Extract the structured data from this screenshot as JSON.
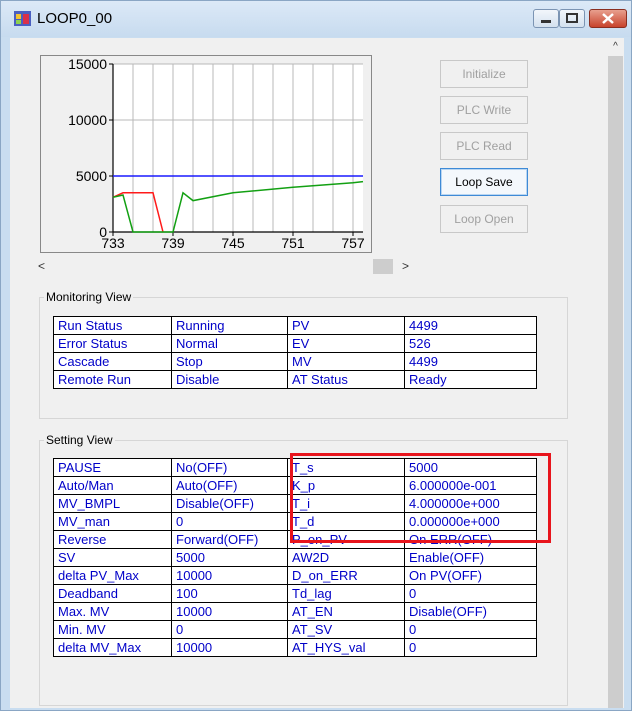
{
  "window": {
    "title": "LOOP0_00"
  },
  "buttons": {
    "initialize": "Initialize",
    "plc_write": "PLC Write",
    "plc_read": "PLC Read",
    "loop_save": "Loop Save",
    "loop_open": "Loop Open"
  },
  "scroll": {
    "up": "^",
    "left": "<",
    "right": ">"
  },
  "chart_data": {
    "type": "line",
    "x": [
      733,
      734,
      735,
      736,
      737,
      738,
      739,
      740,
      741,
      745,
      751,
      757,
      758
    ],
    "xticks": [
      "733",
      "739",
      "745",
      "751",
      "757"
    ],
    "yticks": [
      "0",
      "5000",
      "10000",
      "15000"
    ],
    "ylim": [
      0,
      15000
    ],
    "xlim": [
      733,
      758
    ],
    "grid": true,
    "series": [
      {
        "color": "#1a1aff",
        "values": [
          5000,
          5000,
          5000,
          5000,
          5000,
          5000,
          5000,
          5000,
          5000,
          5000,
          5000,
          5000,
          5000
        ]
      },
      {
        "color": "#ff1a1a",
        "values": [
          3100,
          3500,
          3500,
          3500,
          3500,
          0,
          null,
          null,
          null,
          null,
          null,
          null,
          null
        ]
      },
      {
        "color": "#12a012",
        "values": [
          3100,
          3300,
          0,
          0,
          0,
          0,
          0,
          3500,
          2800,
          3500,
          4000,
          4400,
          4500
        ]
      }
    ]
  },
  "monitoring": {
    "label": "Monitoring View",
    "rows": [
      [
        "Run Status",
        "Running",
        "PV",
        "4499"
      ],
      [
        "Error Status",
        "Normal",
        "EV",
        "526"
      ],
      [
        "Cascade",
        "Stop",
        "MV",
        "4499"
      ],
      [
        "Remote Run",
        "Disable",
        "AT Status",
        "Ready"
      ]
    ]
  },
  "setting": {
    "label": "Setting View",
    "rows": [
      [
        "PAUSE",
        "No(OFF)",
        "T_s",
        "5000"
      ],
      [
        "Auto/Man",
        "Auto(OFF)",
        "K_p",
        "6.000000e-001"
      ],
      [
        "MV_BMPL",
        "Disable(OFF)",
        "T_i",
        "4.000000e+000"
      ],
      [
        "MV_man",
        "0",
        "T_d",
        "0.000000e+000"
      ],
      [
        "Reverse",
        "Forward(OFF)",
        "P_on_PV",
        "On ERR(OFF)"
      ],
      [
        "SV",
        "5000",
        "AW2D",
        "Enable(OFF)"
      ],
      [
        "delta PV_Max",
        "10000",
        "D_on_ERR",
        "On PV(OFF)"
      ],
      [
        "Deadband",
        "100",
        "Td_lag",
        "0"
      ],
      [
        "Max. MV",
        "10000",
        "AT_EN",
        "Disable(OFF)"
      ],
      [
        "Min. MV",
        "0",
        "AT_SV",
        "0"
      ],
      [
        "delta MV_Max",
        "10000",
        "AT_HYS_val",
        "0"
      ]
    ]
  }
}
